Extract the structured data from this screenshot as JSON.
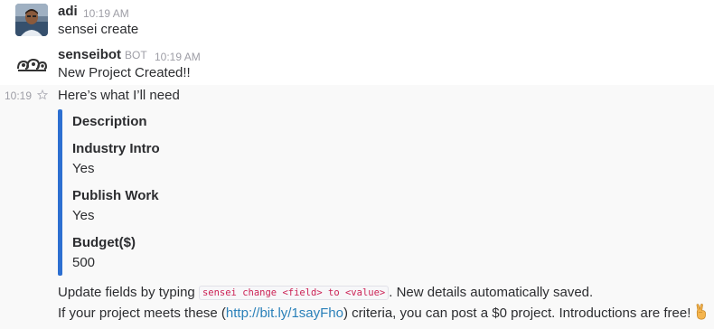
{
  "messages": [
    {
      "author": "adi",
      "time": "10:19 AM",
      "text": "sensei create"
    },
    {
      "author": "senseibot",
      "badge": "BOT",
      "time": "10:19 AM",
      "text": "New Project Created!!"
    }
  ],
  "continuation": {
    "time": "10:19",
    "intro": "Here’s what I’ll need",
    "attachment_color": "#2d6fd1",
    "fields": [
      {
        "title": "Description",
        "value": ""
      },
      {
        "title": "Industry Intro",
        "value": "Yes"
      },
      {
        "title": "Publish Work",
        "value": "Yes"
      },
      {
        "title": "Budget($)",
        "value": "500"
      }
    ],
    "footer1_pre": "Update fields by typing ",
    "footer1_code": "sensei change <field> to <value>",
    "footer1_post": ". New details automatically saved.",
    "footer2_pre": "If your project meets these (",
    "footer2_link": "http://bit.ly/1sayFho",
    "footer2_post": ") criteria, you can post a $0 project. Introductions are free!"
  },
  "icons": {
    "star": "star-icon",
    "emoji": "victory-hand-icon",
    "bot_avatar": "senseibot-avatar-icon"
  }
}
